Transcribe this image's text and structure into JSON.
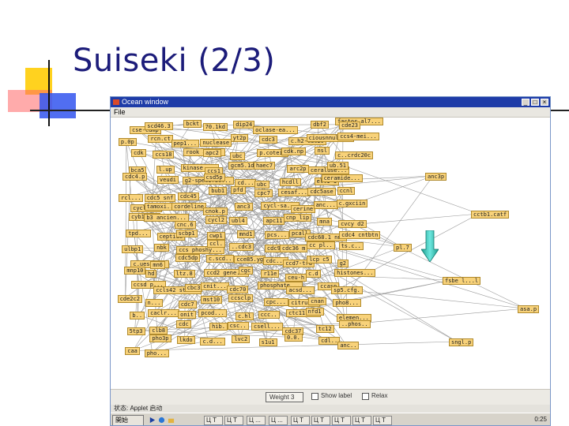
{
  "slide": {
    "title": "Suiseki (2/3)"
  },
  "window": {
    "title": "Ocean window",
    "menu_file": "File",
    "controls": [
      "_",
      "□",
      "×"
    ]
  },
  "graph": {
    "node_color": "#f8d27a",
    "edge_color": "#9a9a9a",
    "nodes": [
      {
        "label": "cse-cdmp"
      },
      {
        "label": "scd46.3"
      },
      {
        "label": "bckt"
      },
      {
        "label": "70.1kd"
      },
      {
        "label": "dip24"
      },
      {
        "label": "oclase-ea..."
      },
      {
        "label": "factor al7..."
      },
      {
        "label": "dbf2"
      },
      {
        "label": "cde23"
      },
      {
        "label": "p.0p"
      },
      {
        "label": "rcn.ct"
      },
      {
        "label": "pep1..."
      },
      {
        "label": "nuclease"
      },
      {
        "label": "yt2p"
      },
      {
        "label": "cdc3"
      },
      {
        "label": "c.h2-cdc20"
      },
      {
        "label": "ciousnnule..."
      },
      {
        "label": "ccs4-mei..."
      },
      {
        "label": "cdk"
      },
      {
        "label": "ccs18"
      },
      {
        "label": "rook ana..."
      },
      {
        "label": "apc2"
      },
      {
        "label": "ubc"
      },
      {
        "label": "p.cotein"
      },
      {
        "label": "cdk.np"
      },
      {
        "label": "nsl"
      },
      {
        "label": "c..crdc20c"
      },
      {
        "label": "bca5"
      },
      {
        "label": "l.up"
      },
      {
        "label": "kinase ..."
      },
      {
        "label": "ccs1"
      },
      {
        "label": "gcm5.1doc..."
      },
      {
        "label": "haec7"
      },
      {
        "label": "arc2p"
      },
      {
        "label": "ceraluse..."
      },
      {
        "label": "ub.51"
      },
      {
        "label": "cdc4.p"
      },
      {
        "label": "veudi"
      },
      {
        "label": "g2-specific..."
      },
      {
        "label": "csd5p"
      },
      {
        "label": "cd..."
      },
      {
        "label": "ubc"
      },
      {
        "label": "hcdll"
      },
      {
        "label": "elt1-1"
      },
      {
        "label": "ceramide..."
      },
      {
        "label": "rcl..."
      },
      {
        "label": "cdc5 snf"
      },
      {
        "label": "cdc45"
      },
      {
        "label": "bub1"
      },
      {
        "label": "pfd"
      },
      {
        "label": "cpc7"
      },
      {
        "label": "cesaf..."
      },
      {
        "label": "cdc5ase"
      },
      {
        "label": "ccnl"
      },
      {
        "label": "cyclin b"
      },
      {
        "label": "tamoxi..."
      },
      {
        "label": "cordeline"
      },
      {
        "label": "cnok.p"
      },
      {
        "label": "anc3"
      },
      {
        "label": "cycl-sa..."
      },
      {
        "label": "cerine"
      },
      {
        "label": "anc..."
      },
      {
        "label": "c.gxciin"
      },
      {
        "label": "cyb1n..."
      },
      {
        "label": "b3 ancien..."
      },
      {
        "label": "cnc.6"
      },
      {
        "label": "cycl2"
      },
      {
        "label": "ubl4"
      },
      {
        "label": "apc11"
      },
      {
        "label": "cnp_lip"
      },
      {
        "label": "mna"
      },
      {
        "label": "cvcy d2"
      },
      {
        "label": "tpd..."
      },
      {
        "label": "ceptide"
      },
      {
        "label": "scbp1"
      },
      {
        "label": "cwp1"
      },
      {
        "label": "mnd1"
      },
      {
        "label": "pcs..."
      },
      {
        "label": "pcall"
      },
      {
        "label": "cdc68.1 nnc"
      },
      {
        "label": "cdc4 cntbtn"
      },
      {
        "label": "ulbp1"
      },
      {
        "label": "nbk"
      },
      {
        "label": "ccs phoshy..."
      },
      {
        "label": "ccl."
      },
      {
        "label": "..cdc3"
      },
      {
        "label": "cdc91"
      },
      {
        "label": "cdc36 m"
      },
      {
        "label": "cc pl.."
      },
      {
        "label": "ts.c.."
      },
      {
        "label": "c.ueset..."
      },
      {
        "label": "mn6"
      },
      {
        "label": "cdc5dp"
      },
      {
        "label": "c.scd.."
      },
      {
        "label": "cce85.yg"
      },
      {
        "label": "cdc..."
      },
      {
        "label": "ccd7-trd"
      },
      {
        "label": "lcp c5"
      },
      {
        "label": "g2"
      },
      {
        "label": "mnp10"
      },
      {
        "label": "hd"
      },
      {
        "label": "ltz.8"
      },
      {
        "label": "ccd2 gene..."
      },
      {
        "label": "cgc"
      },
      {
        "label": "r11e"
      },
      {
        "label": "ceu-h"
      },
      {
        "label": "c.d"
      },
      {
        "label": "histones..."
      },
      {
        "label": "ccsd p..."
      },
      {
        "label": "ccls42 str..."
      },
      {
        "label": "cbc3"
      },
      {
        "label": "cnit..."
      },
      {
        "label": "cdc70"
      },
      {
        "label": "phosphate..."
      },
      {
        "label": "acsd..."
      },
      {
        "label": "ccasp"
      },
      {
        "label": "sp5.cfg."
      },
      {
        "label": "cde2c2"
      },
      {
        "label": "n..."
      },
      {
        "label": "cdc7"
      },
      {
        "label": "mst10"
      },
      {
        "label": "ccsclp"
      },
      {
        "label": "cpc..."
      },
      {
        "label": "citrul.."
      },
      {
        "label": "cnan"
      },
      {
        "label": "pho8..."
      },
      {
        "label": "b.."
      },
      {
        "label": "caclr..."
      },
      {
        "label": "onit"
      },
      {
        "label": "pcod..."
      },
      {
        "label": "c.hl"
      },
      {
        "label": "ccc.."
      },
      {
        "label": "ctc11.ccs"
      },
      {
        "label": "nfd1"
      },
      {
        "label": "elemen..."
      },
      {
        "label": "5tp3"
      },
      {
        "label": "clb8"
      },
      {
        "label": "cdc"
      },
      {
        "label": "hib."
      },
      {
        "label": "csc.."
      },
      {
        "label": "csell..."
      },
      {
        "label": "cdc37"
      },
      {
        "label": "tc12"
      },
      {
        "label": "..phos.."
      },
      {
        "label": "pl.7"
      },
      {
        "label": "pho3p"
      },
      {
        "label": "lkdo"
      },
      {
        "label": "c.d..."
      },
      {
        "label": "lvc2"
      },
      {
        "label": "s1u1"
      },
      {
        "label": "0.0."
      },
      {
        "label": "cdl.."
      },
      {
        "label": "anc.."
      },
      {
        "label": "caa"
      },
      {
        "label": "pho..."
      },
      {
        "label": "anc3p"
      },
      {
        "label": "cctb1.catf"
      },
      {
        "label": "fsbe l...l"
      },
      {
        "label": "asa.p"
      },
      {
        "label": "sngl.p"
      }
    ]
  },
  "controls": {
    "weight_label": "Weight 3",
    "show_label": "Show label",
    "relax_label": "Relax"
  },
  "status": {
    "text": "状态: Applet 启动"
  },
  "taskbar": {
    "start_label": "開始",
    "items": [
      "Ц T",
      "Ц T",
      "Ц ...",
      "Ц ...",
      "Ц T",
      "Ц T",
      "Ц T",
      "Ц T",
      "Ц T"
    ],
    "clock": "0:25"
  }
}
